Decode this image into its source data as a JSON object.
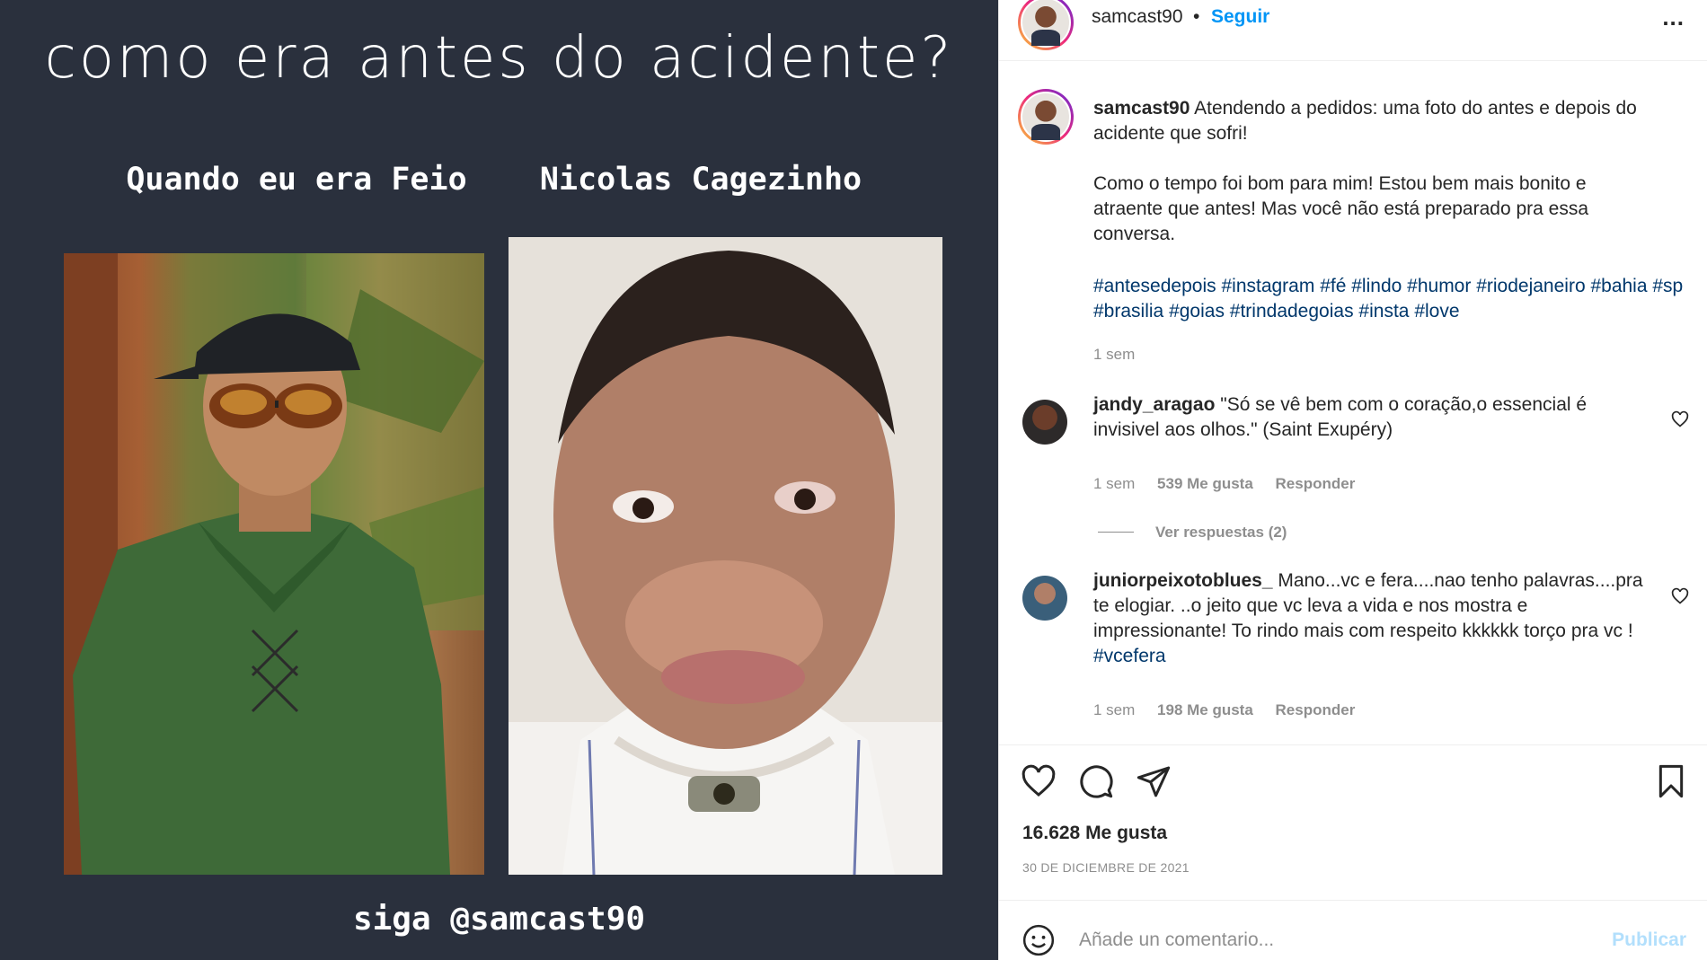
{
  "media": {
    "headline": "como era antes do acidente?",
    "caption_left": "Quando eu era Feio",
    "caption_right": "Nicolas Cagezinho",
    "footer": "siga @samcast90"
  },
  "header": {
    "username": "samcast90",
    "separator": "•",
    "follow_label": "Seguir",
    "more_label": "..."
  },
  "post": {
    "username": "samcast90",
    "line1": " Atendendo a pedidos: uma foto do antes e depois do acidente que sofri!",
    "paragraph2": "Como o tempo foi bom para mim! Estou bem mais bonito e atraente que antes! Mas você não está preparado pra essa conversa.",
    "hashtags": [
      "#antesedepois",
      "#instagram",
      "#fé",
      "#lindo",
      "#humor",
      "#riodejaneiro",
      "#bahia",
      "#sp",
      "#brasilia",
      "#goias",
      "#trindadegoias",
      "#insta",
      "#love"
    ],
    "time": "1 sem"
  },
  "comments": [
    {
      "username": "jandy_aragao",
      "text": " \"Só se vê bem com o coração,o essencial é invisivel aos olhos.\" (Saint Exupéry)",
      "time": "1 sem",
      "likes": "539 Me gusta",
      "reply": "Responder",
      "view_replies": "Ver respuestas (2)"
    },
    {
      "username": "juniorpeixotoblues_",
      "text": " Mano...vc e fera....nao tenho palavras....pra te elogiar. ..o jeito que vc leva a vida e nos mostra e impressionante! To rindo mais com respeito kkkkkk torço pra vc ! ",
      "tag": "#vcefera",
      "time": "1 sem",
      "likes": "198 Me gusta",
      "reply": "Responder"
    }
  ],
  "stats": {
    "likes": "16.628 Me gusta",
    "date": "30 DE DICIEMBRE DE 2021"
  },
  "comment_box": {
    "placeholder": "Añade un comentario...",
    "publish": "Publicar"
  },
  "colors": {
    "media_bg": "#2a303d",
    "link_blue": "#0095f6",
    "hashtag": "#00376b",
    "muted": "#8e8e8e",
    "publish_disabled": "#b2dffc"
  }
}
